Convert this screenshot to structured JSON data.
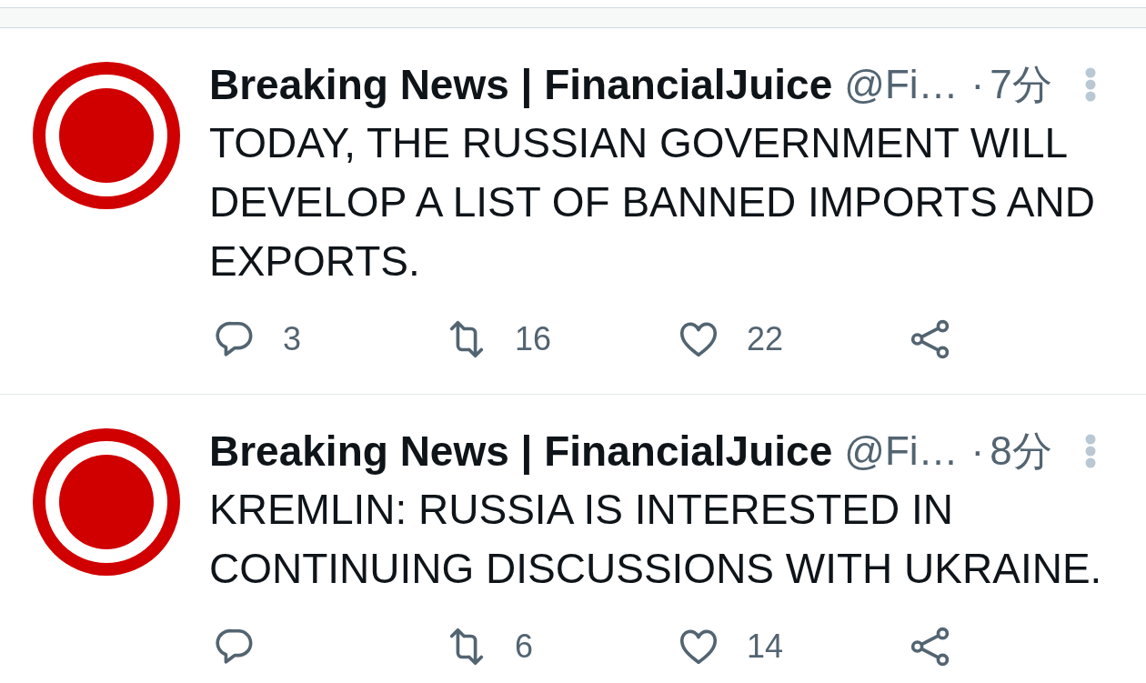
{
  "tweets": [
    {
      "author": "Breaking News | FinancialJuice",
      "handle": "@Fi…",
      "separator": "·",
      "time": "7分",
      "text": "TODAY, THE RUSSIAN GOVERNMENT WILL DEVELOP A LIST OF BANNED IMPORTS AND EXPORTS.",
      "actions": [
        {
          "kind": "reply",
          "count": "3"
        },
        {
          "kind": "retweet",
          "count": "16"
        },
        {
          "kind": "like",
          "count": "22"
        },
        {
          "kind": "share"
        }
      ]
    },
    {
      "author": "Breaking News | FinancialJuice",
      "handle": "@Fi…",
      "separator": "·",
      "time": "8分",
      "text": "KREMLIN: RUSSIA IS INTERESTED IN CONTINUING DISCUSSIONS WITH UKRAINE.",
      "actions": [
        {
          "kind": "reply"
        },
        {
          "kind": "retweet",
          "count": "6"
        },
        {
          "kind": "like",
          "count": "14"
        },
        {
          "kind": "share"
        }
      ]
    }
  ]
}
